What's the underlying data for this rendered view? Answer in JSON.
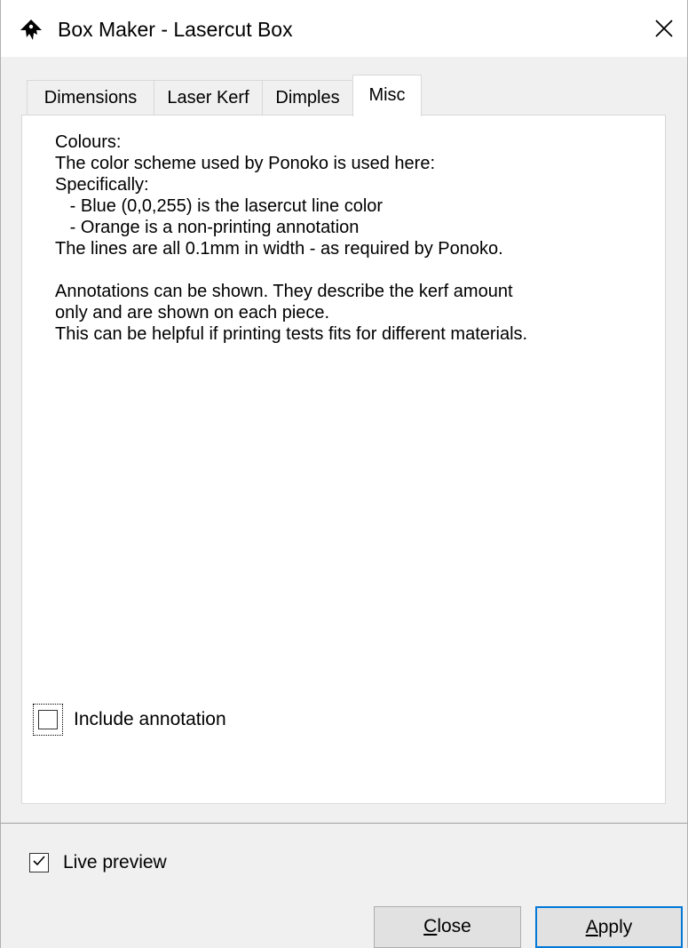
{
  "window": {
    "title": "Box Maker - Lasercut Box",
    "close_glyph": "✕"
  },
  "tabs": [
    {
      "label": "Dimensions",
      "active": false
    },
    {
      "label": "Laser Kerf",
      "active": false
    },
    {
      "label": "Dimples",
      "active": false
    },
    {
      "label": "Misc",
      "active": true
    }
  ],
  "misc": {
    "lines": [
      "Colours:",
      "The color scheme used by Ponoko is used here:",
      "Specifically:",
      "   - Blue (0,0,255) is the lasercut line color",
      "   - Orange is a non-printing annotation",
      "The lines are all 0.1mm in width - as required by Ponoko.",
      "",
      "Annotations can be shown. They describe the kerf amount",
      "only and are shown on each piece.",
      "This can be helpful if printing tests fits for different materials."
    ],
    "include_annotation_label": "Include annotation",
    "include_annotation_checked": false
  },
  "footer": {
    "live_preview_label": "Live preview",
    "live_preview_checked": true,
    "close_mnemonic": "C",
    "close_rest": "lose",
    "apply_mnemonic": "A",
    "apply_rest": "pply"
  },
  "colors": {
    "accent": "#0078d7",
    "button_face": "#e1e1e1"
  },
  "icons": {
    "app": "inkscape-icon",
    "close": "close-icon",
    "check": "checkmark-icon"
  }
}
